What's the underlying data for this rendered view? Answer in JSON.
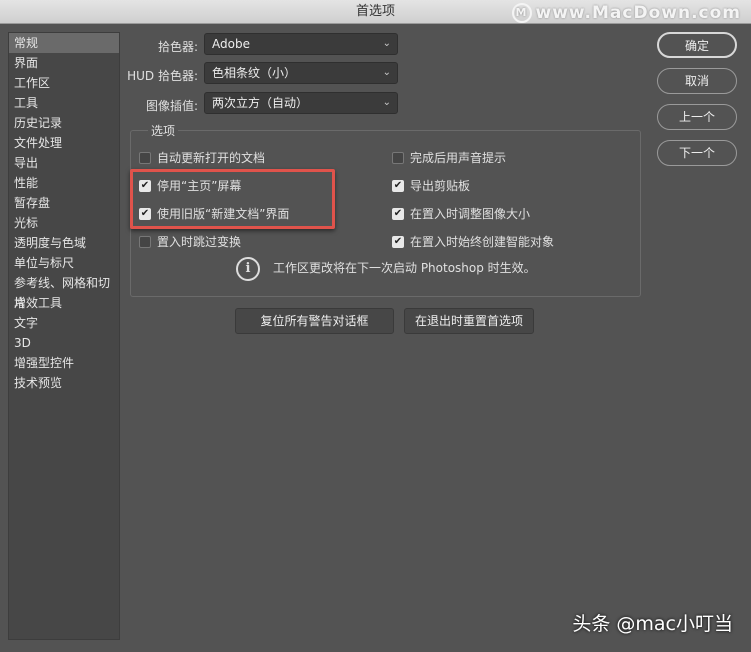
{
  "window": {
    "title": "首选项"
  },
  "watermark": {
    "text": "www.MacDown.com",
    "logo_letter": "M"
  },
  "sidebar": {
    "items": [
      {
        "label": "常规"
      },
      {
        "label": "界面"
      },
      {
        "label": "工作区"
      },
      {
        "label": "工具"
      },
      {
        "label": "历史记录"
      },
      {
        "label": "文件处理"
      },
      {
        "label": "导出"
      },
      {
        "label": "性能"
      },
      {
        "label": "暂存盘"
      },
      {
        "label": "光标"
      },
      {
        "label": "透明度与色域"
      },
      {
        "label": "单位与标尺"
      },
      {
        "label": "参考线、网格和切片"
      },
      {
        "label": "增效工具"
      },
      {
        "label": "文字"
      },
      {
        "label": "3D"
      },
      {
        "label": "增强型控件"
      },
      {
        "label": "技术预览"
      }
    ],
    "active": "常规"
  },
  "fields": {
    "color_picker": {
      "label": "拾色器:",
      "value": "Adobe"
    },
    "hud_picker": {
      "label": "HUD 拾色器:",
      "value": "色相条纹（小）"
    },
    "interpolation": {
      "label": "图像插值:",
      "value": "两次立方（自动）"
    }
  },
  "options": {
    "title": "选项",
    "items": [
      {
        "label": "自动更新打开的文档",
        "checked": false
      },
      {
        "label": "停用“主页”屏幕",
        "checked": true
      },
      {
        "label": "使用旧版“新建文档”界面",
        "checked": true
      },
      {
        "label": "置入时跳过变换",
        "checked": false
      },
      {
        "label": "完成后用声音提示",
        "checked": false
      },
      {
        "label": "导出剪贴板",
        "checked": true
      },
      {
        "label": "在置入时调整图像大小",
        "checked": true
      },
      {
        "label": "在置入时始终创建智能对象",
        "checked": true
      }
    ],
    "info": "工作区更改将在下一次启动 Photoshop 时生效。",
    "info_icon": "i"
  },
  "buttons": {
    "reset_warnings": "复位所有警告对话框",
    "reset_on_quit": "在退出时重置首选项",
    "ok": "确定",
    "cancel": "取消",
    "prev": "上一个",
    "next": "下一个"
  },
  "footer": {
    "text": "头条 @mac小叮当"
  },
  "colors": {
    "highlight": "#e0534b"
  }
}
